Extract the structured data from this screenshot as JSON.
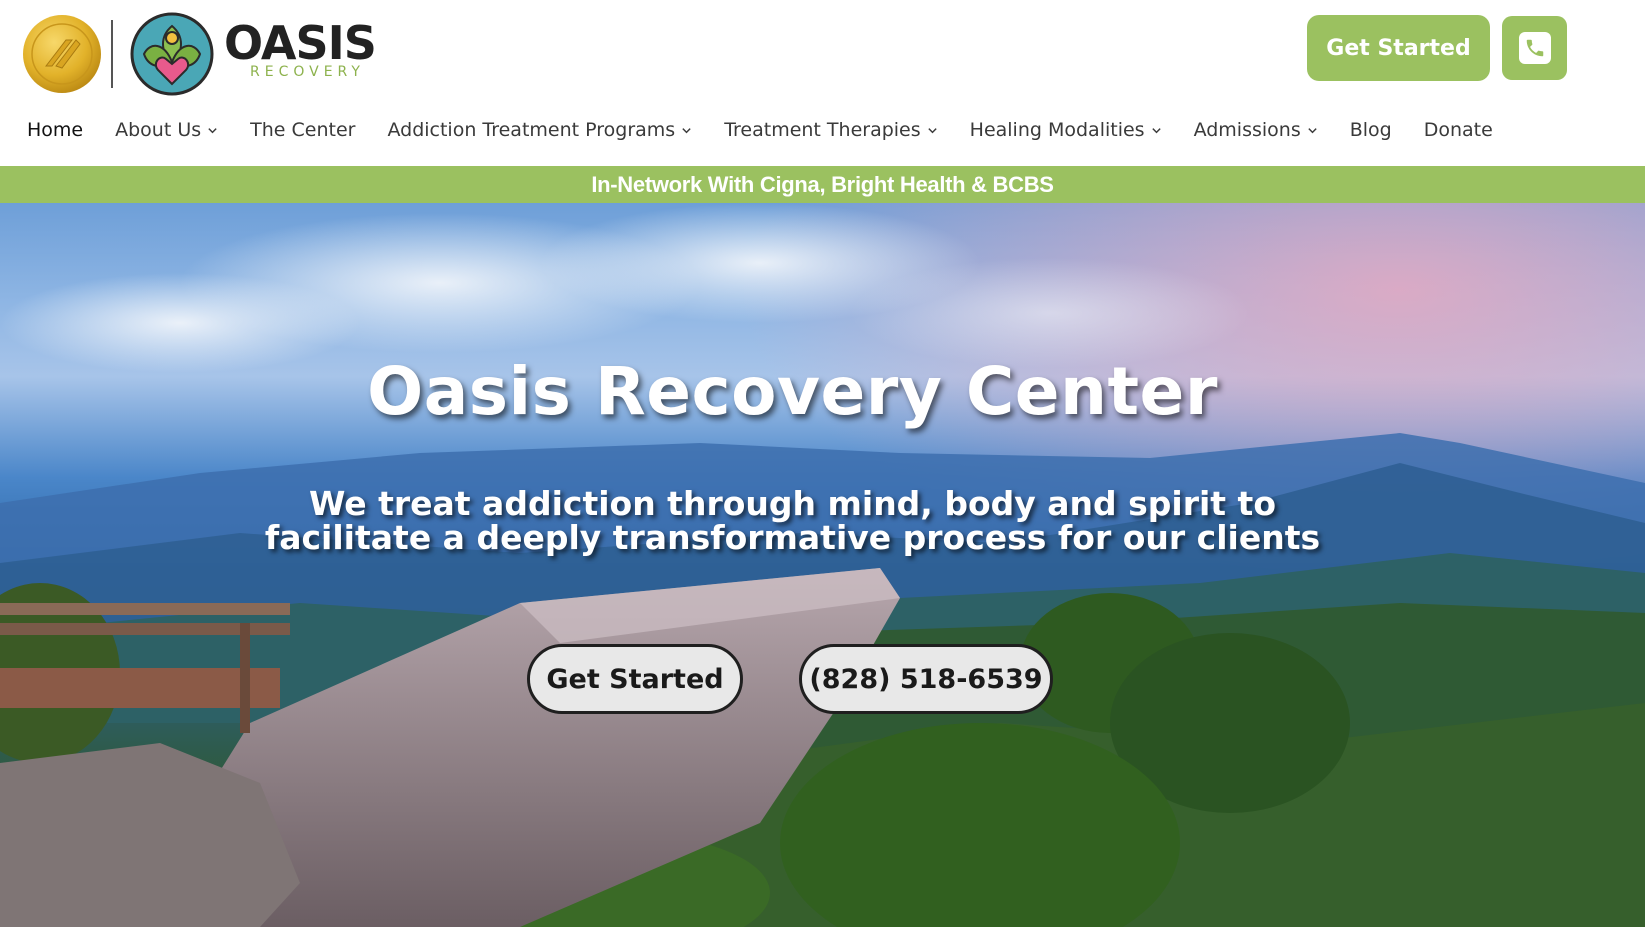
{
  "brand": {
    "name": "OASIS",
    "tagline": "RECOVERY"
  },
  "header": {
    "cta_label": "Get Started",
    "phone_icon": "phone-icon"
  },
  "nav": {
    "items": [
      {
        "label": "Home",
        "has_dropdown": false,
        "active": true
      },
      {
        "label": "About Us",
        "has_dropdown": true
      },
      {
        "label": "The Center",
        "has_dropdown": false
      },
      {
        "label": "Addiction Treatment Programs",
        "has_dropdown": true
      },
      {
        "label": "Treatment Therapies",
        "has_dropdown": true
      },
      {
        "label": "Healing Modalities",
        "has_dropdown": true
      },
      {
        "label": "Admissions",
        "has_dropdown": true
      },
      {
        "label": "Blog",
        "has_dropdown": false
      },
      {
        "label": "Donate",
        "has_dropdown": false
      }
    ]
  },
  "announce": {
    "text": "In-Network With Cigna, Bright Health & BCBS"
  },
  "hero": {
    "title": "Oasis Recovery Center",
    "subtitle_line1": "We treat addiction through mind, body and spirit to",
    "subtitle_line2": "facilitate a deeply transformative process for our clients",
    "cta_primary": "Get Started",
    "cta_phone": "(828) 518-6539"
  },
  "colors": {
    "accent_green": "#9bc160",
    "brand_green_text": "#8db24d",
    "dark_text": "#222222",
    "pill_bg": "#e8e8e8"
  }
}
